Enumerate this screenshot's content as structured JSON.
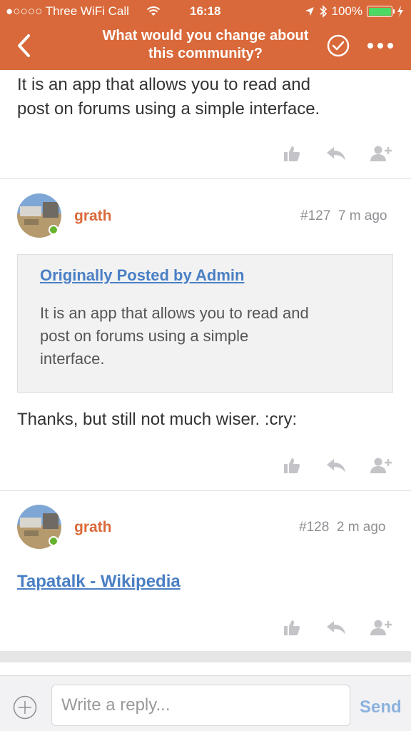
{
  "status_bar": {
    "carrier": "●○○○○ Three WiFi Call",
    "time": "16:18",
    "battery": "100%",
    "battery_level": 1.0
  },
  "nav": {
    "title_line1": "What would you change about",
    "title_line2": "this community?",
    "back_icon": "chevron-left-icon",
    "check_icon": "check-circle-icon",
    "more_icon": "ellipsis-icon"
  },
  "posts": [
    {
      "body_line1": "It is an app that allows you to read and",
      "body_line2": "post on forums using a simple interface."
    },
    {
      "username": "grath",
      "number": "#127",
      "age": "7 m ago",
      "quote_author": "Originally Posted by Admin",
      "quote_line1": "It is an app that allows you to read and",
      "quote_line2": "post on forums using a simple",
      "quote_line3": "interface.",
      "body": "Thanks, but still not much wiser. :cry:"
    },
    {
      "username": "grath",
      "number": "#128",
      "age": "2 m ago",
      "link": "Tapatalk - Wikipedia"
    }
  ],
  "reply": {
    "placeholder": "Write a reply...",
    "send_label": "Send"
  },
  "colors": {
    "accent": "#d9693a",
    "link": "#4a7fc4",
    "online": "#66b32e",
    "send_disabled": "#8bb2de"
  }
}
